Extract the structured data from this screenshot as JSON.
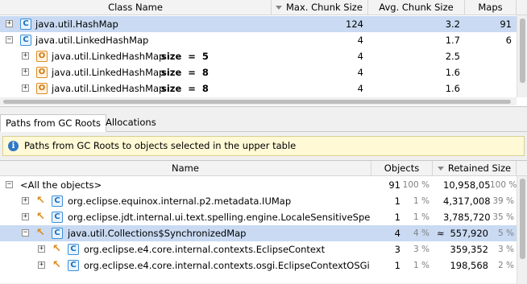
{
  "upper_table": {
    "columns": [
      "Class Name",
      "Max. Chunk Size",
      "Avg. Chunk Size",
      "Maps"
    ],
    "rows": [
      {
        "expander": "+",
        "icon": "C",
        "name": "java.util.HashMap",
        "size_text": "",
        "max": "124",
        "avg": "3.2",
        "maps": "91",
        "selected": true
      },
      {
        "expander": "−",
        "icon": "C",
        "name": "java.util.LinkedHashMap",
        "size_text": "",
        "max": "4",
        "avg": "1.7",
        "maps": "6",
        "selected": false
      },
      {
        "expander": "+",
        "icon": "O",
        "name": "java.util.LinkedHashMap",
        "size_text": "size  =  5",
        "max": "4",
        "avg": "2.5",
        "maps": "",
        "selected": false
      },
      {
        "expander": "+",
        "icon": "O",
        "name": "java.util.LinkedHashMap",
        "size_text": "size  =  8",
        "max": "4",
        "avg": "1.6",
        "maps": "",
        "selected": false
      },
      {
        "expander": "+",
        "icon": "O",
        "name": "java.util.LinkedHashMap",
        "size_text": "size  =  8",
        "max": "4",
        "avg": "1.6",
        "maps": "",
        "selected": false
      }
    ]
  },
  "tabs": [
    {
      "label": "Paths from GC Roots",
      "active": true
    },
    {
      "label": "Allocations",
      "active": false
    }
  ],
  "info_banner": {
    "text": "Paths from GC Roots to objects selected in the upper table",
    "icon": "info-icon"
  },
  "lower_table": {
    "columns": [
      "Name",
      "Objects",
      "Retained Size"
    ],
    "rows": [
      {
        "expander": "−",
        "gc": false,
        "icon": "",
        "name": "<All the objects>",
        "objects": "91",
        "objects_pct": "100 %",
        "approx": "",
        "retained": "10,958,056",
        "retained_pct": "100 %",
        "selected": false
      },
      {
        "expander": "+",
        "gc": true,
        "icon": "C",
        "name": "org.eclipse.equinox.internal.p2.metadata.IUMap",
        "objects": "1",
        "objects_pct": "1 %",
        "approx": "",
        "retained": "4,317,008",
        "retained_pct": "39 %",
        "selected": false
      },
      {
        "expander": "+",
        "gc": true,
        "icon": "C",
        "name": "org.eclipse.jdt.internal.ui.text.spelling.engine.LocaleSensitiveSpellDictio",
        "objects": "1",
        "objects_pct": "1 %",
        "approx": "",
        "retained": "3,785,720",
        "retained_pct": "35 %",
        "selected": false
      },
      {
        "expander": "−",
        "gc": true,
        "icon": "C",
        "name": "java.util.Collections$SynchronizedMap",
        "objects": "4",
        "objects_pct": "4 %",
        "approx": "≈",
        "retained": "557,920",
        "retained_pct": "5 %",
        "selected": true
      },
      {
        "expander": "+",
        "gc": true,
        "icon": "C",
        "name": "org.eclipse.e4.core.internal.contexts.EclipseContext",
        "objects": "3",
        "objects_pct": "3 %",
        "approx": "",
        "retained": "359,352",
        "retained_pct": "3 %",
        "selected": false
      },
      {
        "expander": "+",
        "gc": true,
        "icon": "C",
        "name": "org.eclipse.e4.core.internal.contexts.osgi.EclipseContextOSGi",
        "objects": "1",
        "objects_pct": "1 %",
        "approx": "",
        "retained": "198,568",
        "retained_pct": "2 %",
        "selected": false
      }
    ]
  }
}
